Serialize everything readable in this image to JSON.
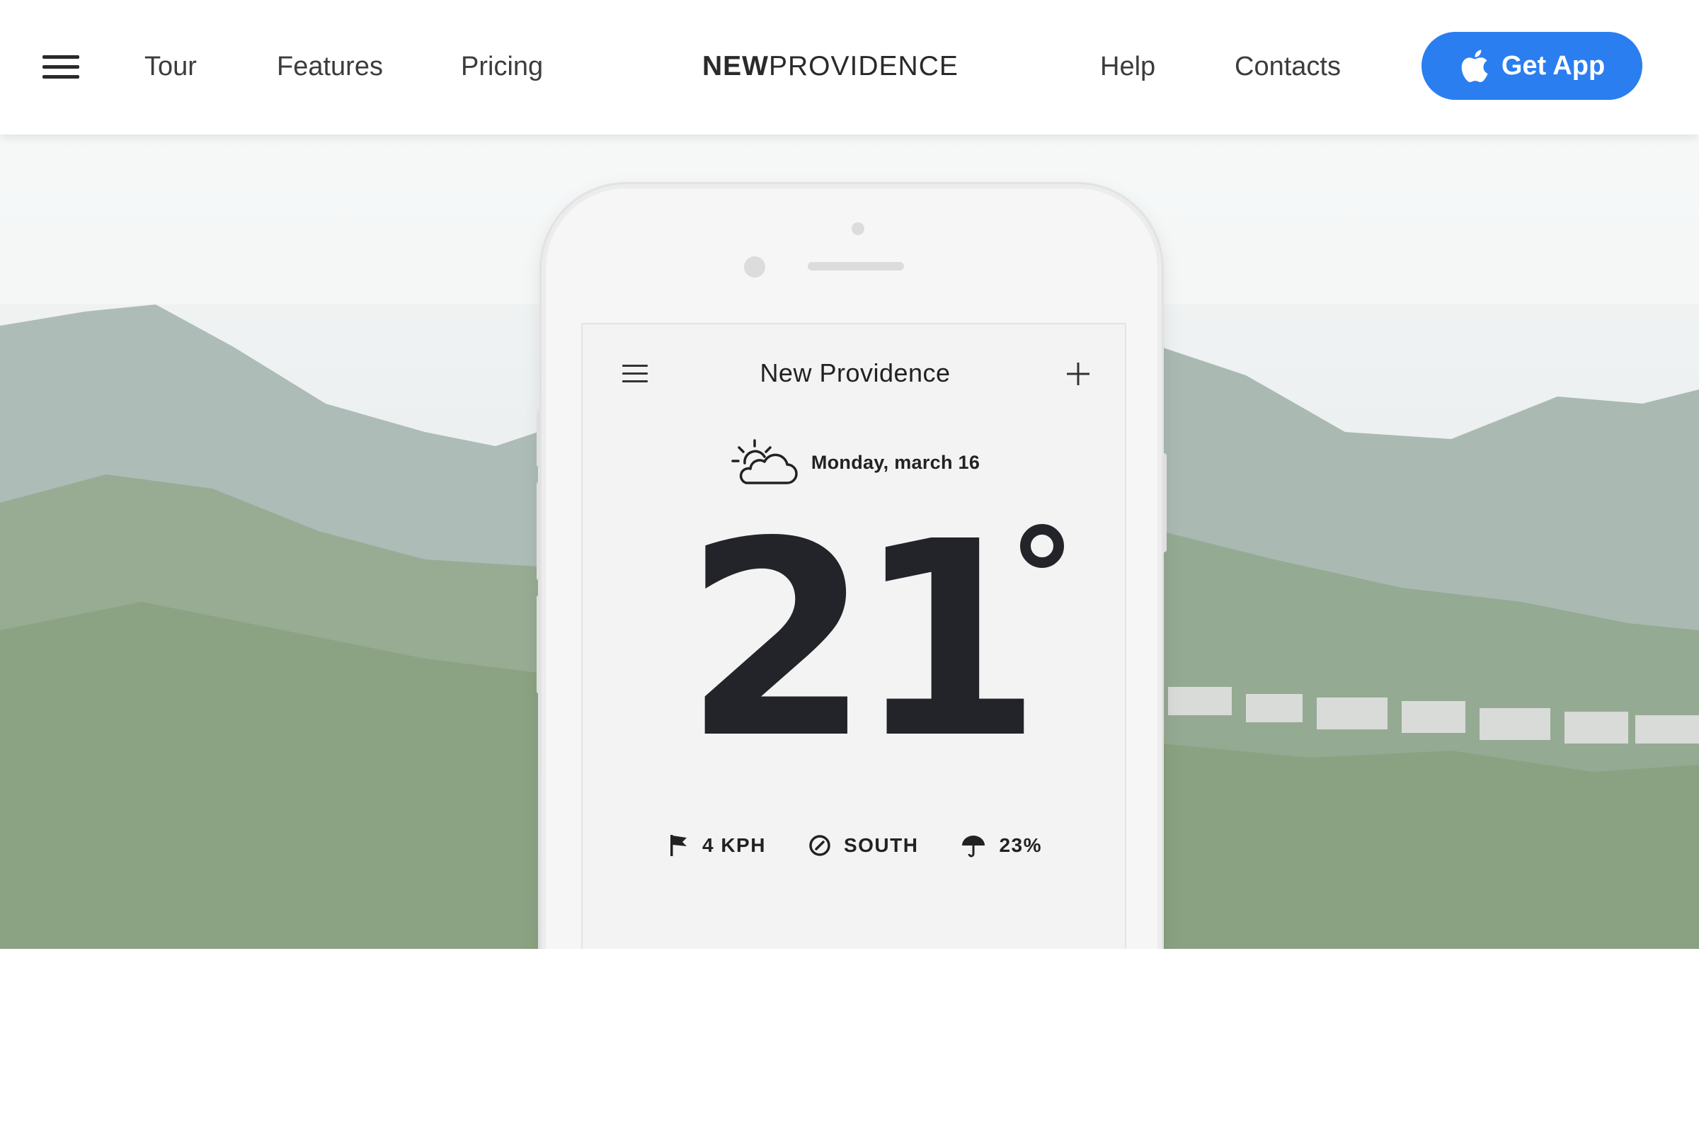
{
  "header": {
    "nav_left": [
      "Tour",
      "Features",
      "Pricing"
    ],
    "logo_bold": "NEW",
    "logo_regular": "PROVIDENCE",
    "nav_right": [
      "Help",
      "Contacts"
    ],
    "cta_label": "Get App",
    "cta_color": "#2a7ef0"
  },
  "phone_app": {
    "city": "New Providence",
    "date": "Monday, march 16",
    "weather_icon": "partly-cloudy-icon",
    "temperature": "21",
    "stats": [
      {
        "icon": "flag-icon",
        "label": "4 KPH"
      },
      {
        "icon": "compass-icon",
        "label": "SOUTH"
      },
      {
        "icon": "umbrella-icon",
        "label": "23%"
      }
    ]
  },
  "colors": {
    "accent": "#2a7ef0",
    "text_dark": "#23242a"
  }
}
